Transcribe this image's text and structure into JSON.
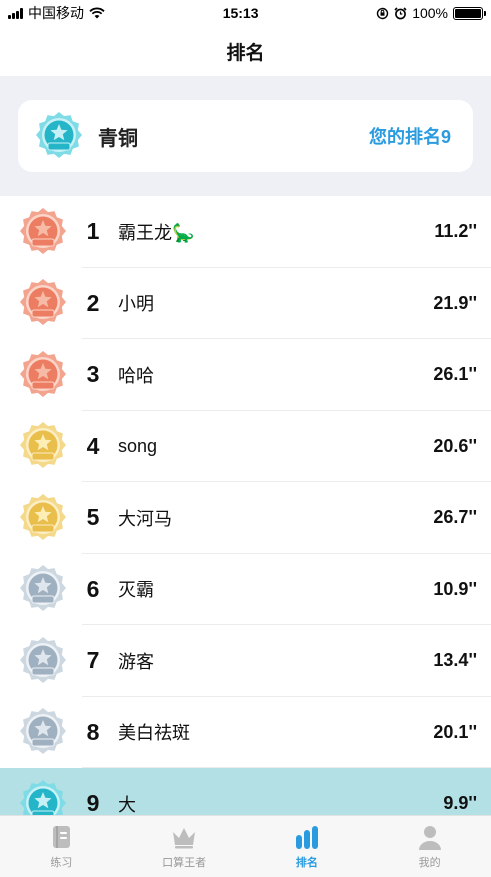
{
  "status_bar": {
    "carrier": "中国移动",
    "time": "15:13",
    "battery": "100%",
    "battery_level": 1.0
  },
  "header": {
    "title": "排名"
  },
  "summary": {
    "tier_name": "青铜",
    "my_rank_label": "您的排名9",
    "medal_color": "teal"
  },
  "ranking": [
    {
      "rank": "1",
      "name": "霸王龙🦕",
      "time": "11.2''",
      "medal": "bronze"
    },
    {
      "rank": "2",
      "name": "小明",
      "time": "21.9''",
      "medal": "bronze"
    },
    {
      "rank": "3",
      "name": "哈哈",
      "time": "26.1''",
      "medal": "bronze"
    },
    {
      "rank": "4",
      "name": "song",
      "time": "20.6''",
      "medal": "gold"
    },
    {
      "rank": "5",
      "name": "大河马",
      "time": "26.7''",
      "medal": "gold"
    },
    {
      "rank": "6",
      "name": "灭霸",
      "time": "10.9''",
      "medal": "silver"
    },
    {
      "rank": "7",
      "name": "游客",
      "time": "13.4''",
      "medal": "silver"
    },
    {
      "rank": "8",
      "name": "美白祛斑",
      "time": "20.1''",
      "medal": "silver"
    },
    {
      "rank": "9",
      "name": "大",
      "time": "9.9''",
      "medal": "teal",
      "highlight": true
    }
  ],
  "tabs": [
    {
      "label": "练习",
      "icon": "book-icon",
      "active": false
    },
    {
      "label": "口算王者",
      "icon": "crown-icon",
      "active": false
    },
    {
      "label": "排名",
      "icon": "bar-chart-icon",
      "active": true
    },
    {
      "label": "我的",
      "icon": "user-icon",
      "active": false
    }
  ],
  "colors": {
    "accent": "#2b9be0",
    "highlight_row": "#b3e0e5",
    "bronze": "#f08c74",
    "gold": "#f0cf6a",
    "silver": "#b9c7d3",
    "teal": "#3ec6d6"
  }
}
